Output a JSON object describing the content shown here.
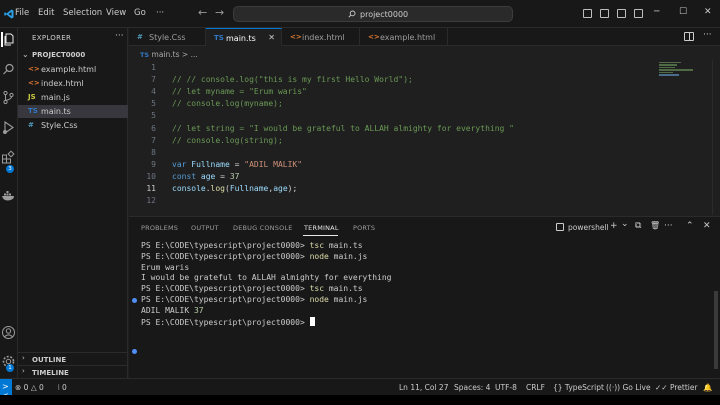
{
  "titlebar": {
    "menu": [
      "File",
      "Edit",
      "Selection",
      "View",
      "Go",
      "···"
    ],
    "back_label": "←",
    "forward_label": "→",
    "search_text": "project0000",
    "window_controls": {
      "minimize": "─",
      "maximize": "☐",
      "close": "✕"
    }
  },
  "activity": {
    "icons": [
      "files-icon",
      "search-icon",
      "source-control-icon",
      "run-debug-icon",
      "extensions-icon",
      "docker-icon",
      "accounts-icon",
      "settings-gear-icon"
    ],
    "extensions_badge": "3",
    "settings_badge": "1"
  },
  "sidebar": {
    "title": "EXPLORER",
    "more": "···",
    "project": "PROJECT0000",
    "files": [
      {
        "icon": "<>",
        "icon_color": "#e37933",
        "name": "example.html"
      },
      {
        "icon": "<>",
        "icon_color": "#e37933",
        "name": "index.html"
      },
      {
        "icon": "JS",
        "icon_color": "#cbcb41",
        "name": "main.js"
      },
      {
        "icon": "TS",
        "icon_color": "#3178c6",
        "name": "main.ts",
        "selected": true
      },
      {
        "icon": "#",
        "icon_color": "#519aba",
        "name": "Style.Css"
      }
    ],
    "outline": "OUTLINE",
    "timeline": "TIMELINE"
  },
  "tabs": [
    {
      "icon": "#",
      "icon_color": "#519aba",
      "name": "Style.Css"
    },
    {
      "icon": "TS",
      "icon_color": "#3178c6",
      "name": "main.ts",
      "active": true,
      "close": "✕"
    },
    {
      "icon": "<>",
      "icon_color": "#e37933",
      "name": "index.html"
    },
    {
      "icon": "<>",
      "icon_color": "#e37933",
      "name": "example.html"
    }
  ],
  "tabs_more": "···",
  "breadcrumb": {
    "icon": "TS",
    "file": "main.ts",
    "sep": ">",
    "rest": "..."
  },
  "editor": {
    "lines": [
      {
        "n": "1",
        "parts": []
      },
      {
        "n": "7",
        "parts": [
          {
            "c": "cmt",
            "t": "// // console.log(\"this is my first Hello World\");"
          }
        ]
      },
      {
        "n": "4",
        "parts": [
          {
            "c": "cmt",
            "t": "// let myname = \"Erum waris\""
          }
        ]
      },
      {
        "n": "5",
        "parts": [
          {
            "c": "cmt",
            "t": "// console.log(myname);"
          }
        ]
      },
      {
        "n": "5",
        "parts": []
      },
      {
        "n": "6",
        "parts": [
          {
            "c": "cmt",
            "t": "// let string = \"I would be grateful to ALLAH almighty for everything \""
          }
        ]
      },
      {
        "n": "7",
        "parts": [
          {
            "c": "cmt",
            "t": "// console.log(string);"
          }
        ]
      },
      {
        "n": "8",
        "parts": []
      },
      {
        "n": "9",
        "parts": [
          {
            "c": "kw",
            "t": "var "
          },
          {
            "c": "var",
            "t": "Fullname"
          },
          {
            "c": "plain",
            "t": " = "
          },
          {
            "c": "str",
            "t": "\"ADIL MALIK\""
          }
        ]
      },
      {
        "n": "10",
        "parts": [
          {
            "c": "kw",
            "t": "const "
          },
          {
            "c": "var",
            "t": "age"
          },
          {
            "c": "plain",
            "t": " = "
          },
          {
            "c": "num",
            "t": "37"
          }
        ]
      },
      {
        "n": "11",
        "current": true,
        "parts": [
          {
            "c": "var",
            "t": "console"
          },
          {
            "c": "plain",
            "t": "."
          },
          {
            "c": "fn",
            "t": "log"
          },
          {
            "c": "plain",
            "t": "("
          },
          {
            "c": "var",
            "t": "Fullname"
          },
          {
            "c": "plain",
            "t": ","
          },
          {
            "c": "var",
            "t": "age"
          },
          {
            "c": "plain",
            "t": ");"
          }
        ]
      },
      {
        "n": "12",
        "parts": []
      }
    ]
  },
  "panel": {
    "tabs": [
      "PROBLEMS",
      "OUTPUT",
      "DEBUG CONSOLE",
      "TERMINAL",
      "PORTS"
    ],
    "active_tab": "TERMINAL",
    "terminal_kind": "powershell",
    "controls": {
      "add": "+",
      "dropdown": "⌄",
      "split": "⧉",
      "trash": "🗑",
      "more": "···",
      "maximize": "⌃",
      "close": "✕"
    },
    "lines": [
      {
        "prompt": "PS E:\\CODE\\typescript\\project0000> ",
        "cmd": "tsc",
        "arg": " main.ts"
      },
      {
        "prompt": "PS E:\\CODE\\typescript\\project0000> ",
        "cmd": "node",
        "arg": " main.js"
      },
      {
        "out": "Erum waris"
      },
      {
        "out": "I would be grateful to ALLAH almighty for everything"
      },
      {
        "prompt": "PS E:\\CODE\\typescript\\project0000> ",
        "cmd": "tsc",
        "arg": " main.ts"
      },
      {
        "prompt": "PS E:\\CODE\\typescript\\project0000> ",
        "cmd": "node",
        "arg": " main.js"
      },
      {
        "out": "ADIL MALIK ",
        "num": "37"
      },
      {
        "prompt": "PS E:\\CODE\\typescript\\project0000> ",
        "cursor": true
      }
    ]
  },
  "status": {
    "remote": "><",
    "errors": "⊗ 0 △ 0",
    "ports": "⦚ 0",
    "position": "Ln 11, Col 27",
    "spaces": "Spaces: 4",
    "encoding": "UTF-8",
    "eol": "CRLF",
    "language": "{} TypeScript",
    "golive": "((·)) Go Live",
    "prettier": "✓✓ Prettier",
    "bell": "🔔"
  },
  "colors": {
    "accent": "#0078d4",
    "comment": "#6a9955",
    "keyword": "#569cd6",
    "string": "#ce9178"
  }
}
